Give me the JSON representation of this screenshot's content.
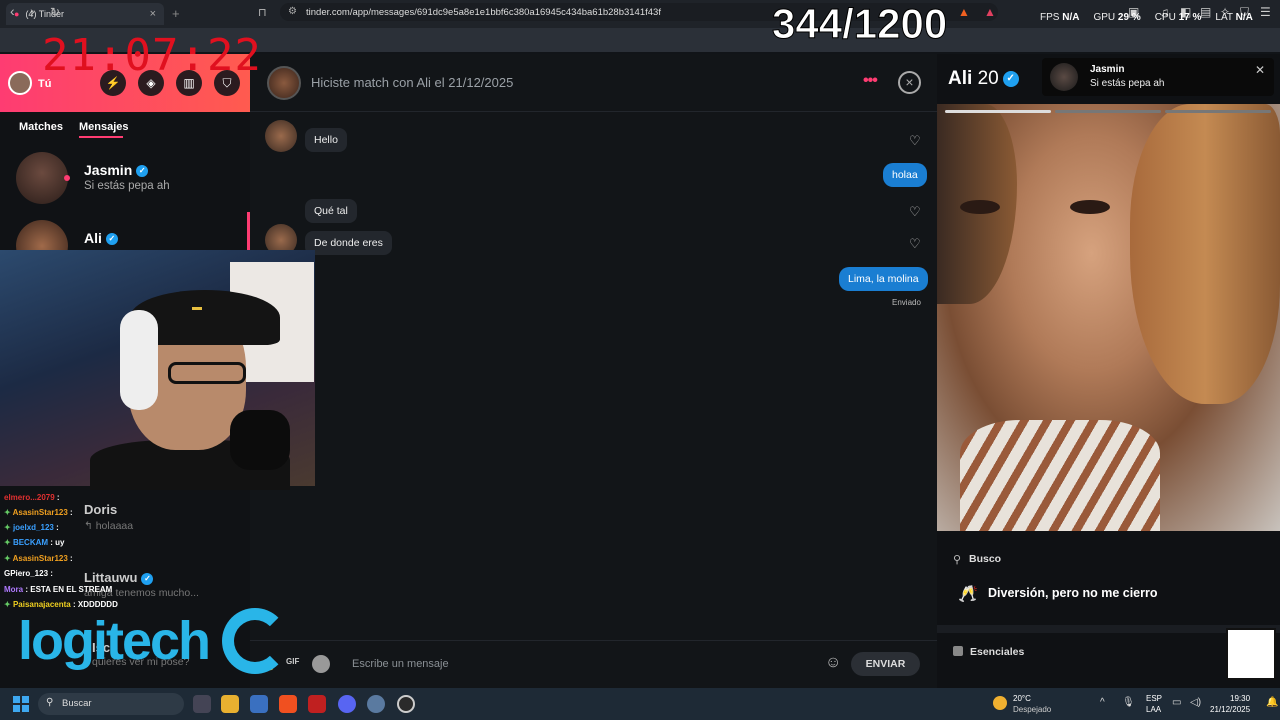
{
  "browser": {
    "tab_title": "(4) Tinder",
    "url": "tinder.com/app/messages/691dc9e5a8e1e1bbf6c380a16945c434ba61b28b3141f43f"
  },
  "overlay": {
    "clock": "21:07:22",
    "counter": "344/1200",
    "fps_label": "FPS",
    "fps_value": "N/A",
    "gpu_label": "GPU",
    "gpu_value": "29 %",
    "cpu_label": "CPU",
    "cpu_value": "17 %",
    "lat_label": "LAT",
    "lat_value": "N/A"
  },
  "sidebar": {
    "me_label": "Tú",
    "tabs": [
      "Matches",
      "Mensajes"
    ],
    "conversations": [
      {
        "name": "Jasmin",
        "message": "Si estás pepa ah"
      },
      {
        "name": "Ali",
        "message": ""
      },
      {
        "name": "Doris",
        "message": "holaaaa"
      },
      {
        "name": "Littauwu",
        "message": "amiga tenemos mucho..."
      },
      {
        "name": "Isco",
        "message": "quieres ver mi pose?"
      }
    ]
  },
  "stream_chat": [
    {
      "user": "elmero...2079",
      "text": ""
    },
    {
      "user": "AsasinStar123",
      "text": ""
    },
    {
      "user": "joelxd_123",
      "text": ""
    },
    {
      "user": "BECKAM",
      "text": "uy"
    },
    {
      "user": "AsasinStar123",
      "text": ""
    },
    {
      "user": "GPiero_123",
      "text": ""
    },
    {
      "user": "Mora",
      "text": "ESTA EN EL STREAM"
    },
    {
      "user": "Paisanajacenta",
      "text": "XDDDDDD"
    }
  ],
  "sponsor": "logitech",
  "chat": {
    "header": "Hiciste match con Ali el 21/12/2025",
    "messages": [
      {
        "side": "left",
        "text": "Hello"
      },
      {
        "side": "right",
        "text": "holaa"
      },
      {
        "side": "left",
        "text": "Qué tal"
      },
      {
        "side": "left",
        "text": "De donde eres"
      },
      {
        "side": "right",
        "text": "Lima, la molina"
      }
    ],
    "sent_status": "Enviado",
    "gif_label": "GIF",
    "input_placeholder": "Escribe un mensaje",
    "send_label": "ENVIAR"
  },
  "profile": {
    "name": "Ali",
    "age": "20",
    "looking_label": "Busco",
    "looking_value": "Diversión, pero no me cierro",
    "essentials_label": "Esenciales"
  },
  "notification": {
    "name": "Jasmin",
    "message": "Si estás pepa ah"
  },
  "taskbar": {
    "search": "Buscar",
    "temperature": "20°C",
    "condition": "Despejado",
    "lang1": "ESP",
    "lang2": "LAA",
    "time": "19:30",
    "date": "21/12/2025"
  },
  "colors": {
    "brand": "#fe3c72",
    "bubble_sent": "#1a7ed2",
    "verified": "#1fa0f0",
    "clock": "#e0101f"
  }
}
